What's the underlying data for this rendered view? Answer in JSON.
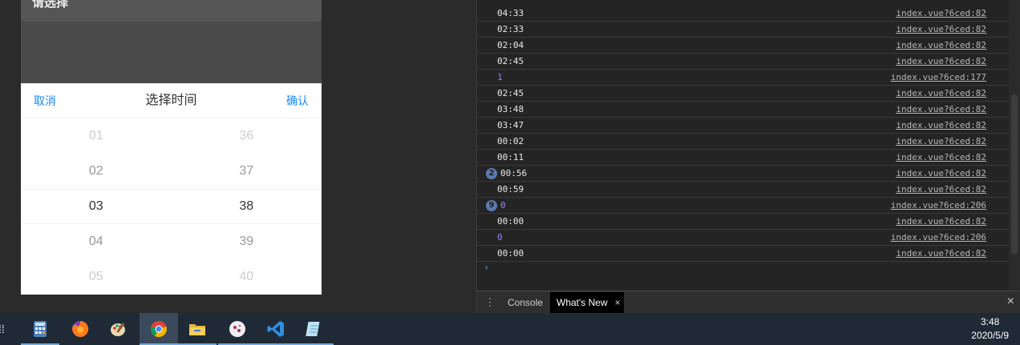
{
  "phone": {
    "card_text": "请选择",
    "picker": {
      "cancel_label": "取消",
      "title": "选择时间",
      "confirm_label": "确认",
      "hours": [
        "01",
        "02",
        "03",
        "04",
        "05"
      ],
      "minutes": [
        "36",
        "37",
        "38",
        "39",
        "40"
      ],
      "selected_hour": "03",
      "selected_minute": "38"
    }
  },
  "console": {
    "rows": [
      {
        "msg": "04:33",
        "src": "index.vue?6ced:82"
      },
      {
        "msg": "02:33",
        "src": "index.vue?6ced:82"
      },
      {
        "msg": "02:04",
        "src": "index.vue?6ced:82"
      },
      {
        "msg": "02:45",
        "src": "index.vue?6ced:82"
      },
      {
        "msg": "1",
        "src": "index.vue?6ced:177",
        "numeric": true
      },
      {
        "msg": "02:45",
        "src": "index.vue?6ced:82"
      },
      {
        "msg": "03:48",
        "src": "index.vue?6ced:82"
      },
      {
        "msg": "03:47",
        "src": "index.vue?6ced:82"
      },
      {
        "msg": "00:02",
        "src": "index.vue?6ced:82"
      },
      {
        "msg": "00:11",
        "src": "index.vue?6ced:82"
      },
      {
        "msg": "00:56",
        "src": "index.vue?6ced:82",
        "badge": "2"
      },
      {
        "msg": "00:59",
        "src": "index.vue?6ced:82"
      },
      {
        "msg": "0",
        "src": "index.vue?6ced:206",
        "numeric": true,
        "badge": "9"
      },
      {
        "msg": "00:00",
        "src": "index.vue?6ced:82"
      },
      {
        "msg": "0",
        "src": "index.vue?6ced:206",
        "numeric": true
      },
      {
        "msg": "00:00",
        "src": "index.vue?6ced:82"
      }
    ],
    "prompt": "›"
  },
  "drawer": {
    "menu_icon": "⋮",
    "tabs": [
      {
        "label": "Console",
        "active": false
      },
      {
        "label": "What's New",
        "active": true,
        "closable": true
      }
    ],
    "tab_close": "×",
    "close": "×"
  },
  "taskbar": {
    "apps": [
      {
        "name": "calculator-icon",
        "active": false
      },
      {
        "name": "firefox-icon",
        "active": false
      },
      {
        "name": "paint-icon",
        "active": false
      },
      {
        "name": "chrome-icon",
        "active": true
      },
      {
        "name": "file-explorer-icon",
        "active": false
      },
      {
        "name": "app-icon",
        "active": false
      },
      {
        "name": "vscode-icon",
        "active": false
      },
      {
        "name": "notepad-icon",
        "active": false
      }
    ],
    "time": "3:48",
    "date": "2020/5/9"
  },
  "colors": {
    "accent": "#1989fa",
    "console_number": "#9980ff",
    "taskbar": "#1f2a36"
  }
}
